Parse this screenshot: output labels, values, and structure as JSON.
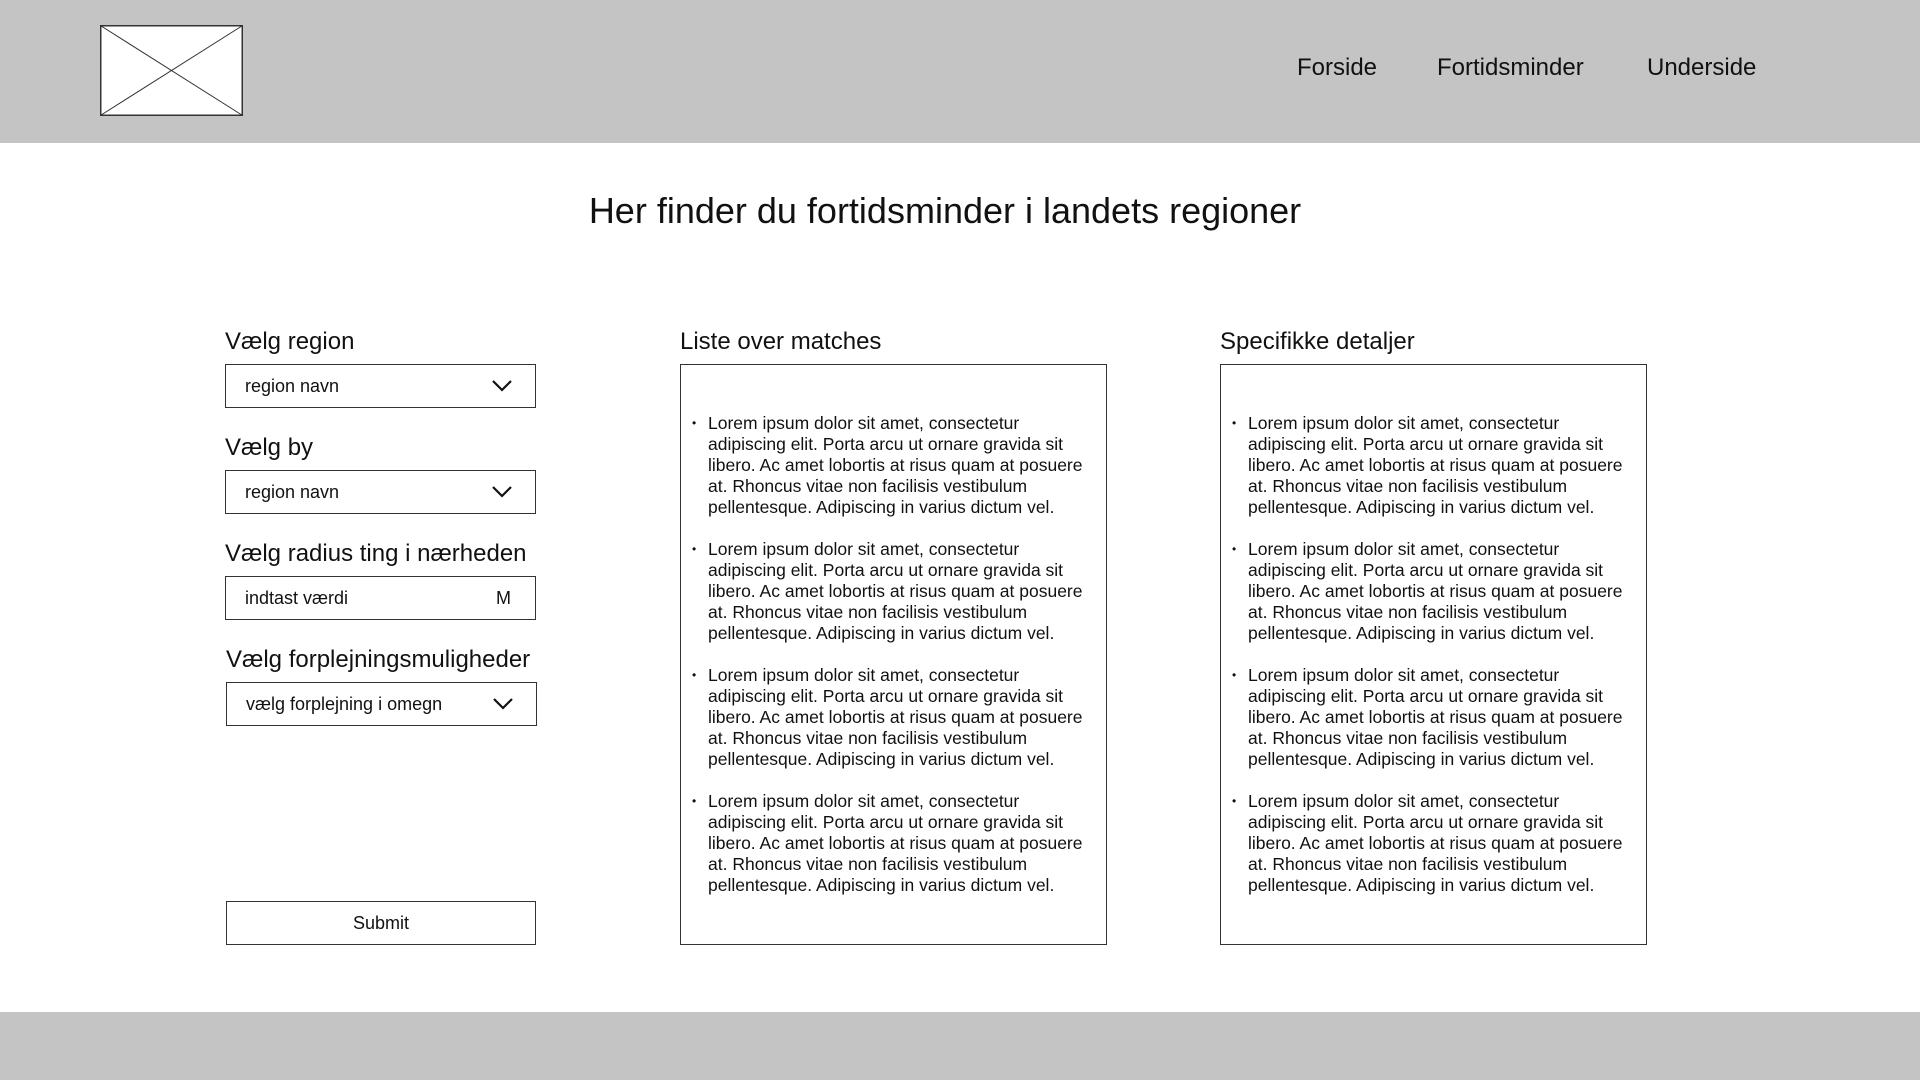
{
  "nav": {
    "items": [
      "Forside",
      "Fortidsminder",
      "Underside"
    ]
  },
  "page": {
    "title": "Her finder du fortidsminder i landets regioner"
  },
  "form": {
    "region": {
      "label": "Vælg region",
      "value": "region navn"
    },
    "city": {
      "label": "Vælg by",
      "value": "region navn"
    },
    "radius": {
      "label": "Vælg radius ting i nærheden",
      "placeholder": "indtast værdi",
      "unit": "M"
    },
    "catering": {
      "label": "Vælg forplejningsmuligheder",
      "value": "vælg forplejning i omegn"
    },
    "submit_label": "Submit"
  },
  "matches": {
    "title": "Liste over matches",
    "items": [
      "Lorem ipsum dolor sit amet, consectetur adipiscing elit. Porta arcu ut ornare gravida sit libero. Ac amet lobortis at risus quam at posuere at. Rhoncus vitae non facilisis vestibulum pellentesque. Adipiscing in varius dictum vel.",
      "Lorem ipsum dolor sit amet, consectetur adipiscing elit. Porta arcu ut ornare gravida sit libero. Ac amet lobortis at risus quam at posuere at. Rhoncus vitae non facilisis vestibulum pellentesque. Adipiscing in varius dictum vel.",
      "Lorem ipsum dolor sit amet, consectetur adipiscing elit. Porta arcu ut ornare gravida sit libero. Ac amet lobortis at risus quam at posuere at. Rhoncus vitae non facilisis vestibulum pellentesque. Adipiscing in varius dictum vel.",
      "Lorem ipsum dolor sit amet, consectetur adipiscing elit. Porta arcu ut ornare gravida sit libero. Ac amet lobortis at risus quam at posuere at. Rhoncus vitae non facilisis vestibulum pellentesque. Adipiscing in varius dictum vel."
    ]
  },
  "details": {
    "title": "Specifikke detaljer",
    "items": [
      "Lorem ipsum dolor sit amet, consectetur adipiscing elit. Porta arcu ut ornare gravida sit libero. Ac amet lobortis at risus quam at posuere at. Rhoncus vitae non facilisis vestibulum pellentesque. Adipiscing in varius dictum vel.",
      "Lorem ipsum dolor sit amet, consectetur adipiscing elit. Porta arcu ut ornare gravida sit libero. Ac amet lobortis at risus quam at posuere at. Rhoncus vitae non facilisis vestibulum pellentesque. Adipiscing in varius dictum vel.",
      "Lorem ipsum dolor sit amet, consectetur adipiscing elit. Porta arcu ut ornare gravida sit libero. Ac amet lobortis at risus quam at posuere at. Rhoncus vitae non facilisis vestibulum pellentesque. Adipiscing in varius dictum vel.",
      "Lorem ipsum dolor sit amet, consectetur adipiscing elit. Porta arcu ut ornare gravida sit libero. Ac amet lobortis at risus quam at posuere at. Rhoncus vitae non facilisis vestibulum pellentesque. Adipiscing in varius dictum vel."
    ]
  },
  "icons": {
    "logo": "image-placeholder-icon",
    "dropdown": "chevron-down-icon"
  },
  "colors": {
    "header_bg": "#c4c4c4",
    "footer_bg": "#c4c4c4",
    "border": "#333333"
  }
}
